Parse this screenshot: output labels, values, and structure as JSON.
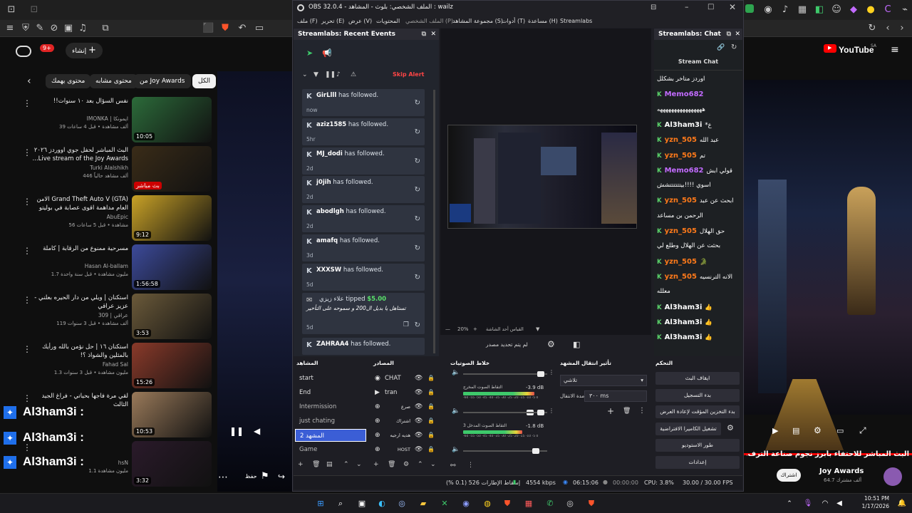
{
  "obs": {
    "title": "OBS 32.0.4 - الملف الشخصي: بلوث - المشاهد : wailz",
    "menu": [
      "ملف (F)",
      "تحرير (E)",
      "عرض (V)",
      "المحتويات",
      "الملف الشخصي (P)",
      "مجموعة المشاهد (S)",
      "أدوات (T)",
      "مساعدة (H)",
      "Streamlabs"
    ],
    "recent_events": {
      "title": "Streamlabs: Recent Events",
      "skip_alert": "Skip Alert",
      "events": [
        {
          "user": "GirLlll",
          "text": " has followed.",
          "time": "now"
        },
        {
          "user": "aziz1585",
          "text": " has followed.",
          "time": "5hr"
        },
        {
          "user": "MJ_dodi",
          "text": " has followed.",
          "time": "2d"
        },
        {
          "user": "j0jih",
          "text": " has followed.",
          "time": "2d"
        },
        {
          "user": "abodlgh",
          "text": " has followed.",
          "time": "2d"
        },
        {
          "user": "amafq",
          "text": " has followed.",
          "time": "3d"
        },
        {
          "user": "XXXSW",
          "text": " has followed.",
          "time": "5d"
        }
      ],
      "tip": {
        "user": "علاء زيزي",
        "text": "tipped",
        "amount": "$5.00",
        "message": "تستاهل يا بديل ال200 و سموحه على التأخير",
        "time": "5d"
      },
      "last_event": {
        "user": "ZAHRAA4",
        "text": " has followed."
      }
    },
    "preview": {
      "zoom": "20%",
      "caption": "لم يتم تحديد مصدر",
      "label": "القياس أحد الشاشة"
    },
    "chat": {
      "title": "Streamlabs: Chat",
      "header": "Stream Chat",
      "lines": [
        {
          "user": "",
          "msg": "اوردز متأخر بشكلل"
        },
        {
          "user": "Memo682",
          "msg": ""
        },
        {
          "user": "",
          "msg": "ههههههههههههههههه"
        },
        {
          "user": "Al3ham3i",
          "msg": "*ع"
        },
        {
          "user": "yzn_505",
          "msg": "عبد الله"
        },
        {
          "user": "yzn_505",
          "msg": "تم"
        },
        {
          "user": "Memo682",
          "msg": "قولي ابش"
        },
        {
          "user": "",
          "msg": "اسوي !!!!بيتتتتتتشش"
        },
        {
          "user": "yzn_505",
          "msg": "ابحث عن عبد"
        },
        {
          "user": "",
          "msg": "الرحمن بن مساعد"
        },
        {
          "user": "yzn_505",
          "msg": "حق الهلال"
        },
        {
          "user": "",
          "msg": "بحثت عن الهلال وطلع لي"
        },
        {
          "user": "yzn_505",
          "msg": "🐊"
        },
        {
          "user": "yzn_505",
          "msg": "الانه الترنسيه"
        },
        {
          "user": "",
          "msg": "معلله"
        },
        {
          "user": "Al3ham3i",
          "msg": "👍"
        },
        {
          "user": "Al3ham3i",
          "msg": "👍"
        },
        {
          "user": "Al3ham3i",
          "msg": "👍"
        }
      ]
    },
    "docks": {
      "scenes_title": "المشاهد",
      "sources_title": "المصادر",
      "mixer_title": "خلاط الصوتيات",
      "transitions_title": "تأثير انتقال المشهد",
      "controls_title": "التحكم"
    },
    "scenes": [
      "start",
      "End",
      "Intermission",
      "just chating",
      "المشهد 2",
      "Game"
    ],
    "sources": [
      {
        "name": "CHAT",
        "icon": "chat-icon"
      },
      {
        "name": "tran",
        "icon": "play-icon"
      },
      {
        "name": "صرع",
        "icon": "globe-icon"
      },
      {
        "name": "اشتراك",
        "icon": "globe-icon"
      },
      {
        "name": "هديه ارجيه",
        "icon": "globe-icon"
      },
      {
        "name": "HOST",
        "icon": "globe-icon"
      }
    ],
    "mixer": [
      {
        "name": "التقاط الصوت المخرج",
        "db": "-3.9 dB",
        "level": 0.85
      },
      {
        "name": "التقاط الصوت المدخل 3",
        "db": "-1.8 dB",
        "level": 0.7
      }
    ],
    "transition": {
      "name": "تلاشي",
      "duration_label": "مدة الانتقال",
      "duration": "٣٠٠ ms"
    },
    "controls": [
      "ايقاف البث",
      "بدء التسجيل",
      "بدء التخزين المؤقت لإعادة العرض",
      "تشغيل الكاميرا الافتراضية",
      "طور الاستوديو",
      "إعدادات"
    ],
    "status": {
      "dropped": "إسقاط الإطارات 526 (0.1 %)",
      "bitrate": "4554 kbps",
      "live": "06:15:06",
      "rec": "00:00:00",
      "cpu": "CPU: 3.8%",
      "fps": "30.00 / 30.00 FPS"
    }
  },
  "yt_left": {
    "create": "إنشاء",
    "notif": "9+",
    "chips": [
      "الكل",
      "من Joy Awards",
      "محتوى مشابه",
      "محتوى يهمك"
    ],
    "videos": [
      {
        "title": "نفس السؤال بعد ١٠ سنوات!!",
        "channel": "IMONKA | ايمونكا",
        "meta": "39 ألف مشاهدة • قبل 4 ساعات",
        "dur": "10:05",
        "color": "#2c6b3a"
      },
      {
        "title": "البث المباشر لحفل جوي اووردز ٢٠٢٦ Live stream of the Joy Awards...",
        "channel": "Turki Alalshikh",
        "meta": "446 ألف مشاهد حالياً",
        "dur": "بث مباشر",
        "color": "#3a2c18"
      },
      {
        "title": "Grand Theft Auto V (GTA) الامن العام مداهمة اقوى عصابة في بوليتو",
        "channel": "AbuEpic",
        "meta": "56 مشاهدة • قبل 5 ساعات",
        "dur": "9:12",
        "color": "#c9a227"
      },
      {
        "title": "مسرحية ممنوع من الرقابة | كاملة",
        "channel": "Hasan Al-ballam",
        "meta": "1.7 مليون مشاهدة • قبل سنة واحدة",
        "dur": "1:56:58",
        "color": "#3c4a9a"
      },
      {
        "title": "استكنان | ويلي من دار الحيره بعلني - عزيز عراقي",
        "channel": "309 | عراقي",
        "meta": "119 ألف مشاهدة • قبل 3 سنوات",
        "dur": "3:53",
        "color": "#6b5a3a"
      },
      {
        "title": "استكنان ١٦ | حل نؤمن بالله ورأيك بالمثلين والشواذ ؟!",
        "channel": "Fahad Sal",
        "meta": "1.3 مليون مشاهدة • قبل 3 سنوات",
        "dur": "15:26",
        "color": "#8a3a2a"
      },
      {
        "title": "لقي مرة فاجها بحياتي - فراغ الجيد الثالث",
        "channel": "",
        "meta": "",
        "dur": "10:53",
        "color": "#9a7a5a"
      },
      {
        "title": "",
        "channel": "hsN",
        "meta": "1.1 مليون مشاهدة",
        "dur": "3:32",
        "color": "#2a1a2a"
      }
    ],
    "overlay_name": "Al3ham3i :"
  },
  "yt_right": {
    "logo": "YouTube",
    "logo_sa": "SA",
    "title": "البث المباشر للاحتفاء بأبرز نجوم صناعة الترف...",
    "channel": "Joy Awards",
    "subs": "64.7 ألف مشترك",
    "subscribe": "اشتراك"
  },
  "player_left": {
    "save": "حفظ"
  },
  "taskbar": {
    "time": "10:51 PM",
    "date": "1/17/2026"
  },
  "colors": {
    "accent": "#3b5ed6",
    "live": "#ff0000",
    "follow_green": "#5bd36b",
    "user_orange": "#ff7a1a",
    "user_purple": "#c26bff"
  }
}
